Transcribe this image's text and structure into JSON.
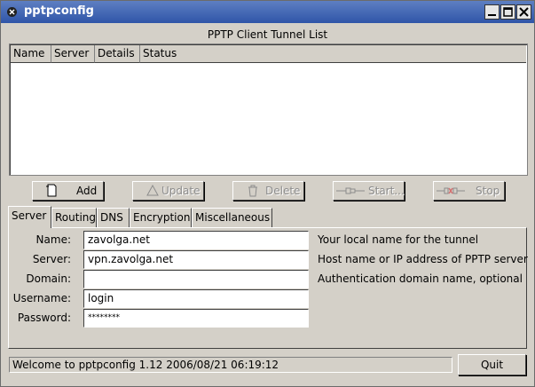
{
  "window": {
    "title": "pptpconfig"
  },
  "list": {
    "caption": "PPTP Client Tunnel List",
    "columns": [
      "Name",
      "Server",
      "Details",
      "Status"
    ]
  },
  "toolbar": {
    "add": "Add",
    "update": "Update",
    "delete": "Delete",
    "start": "Start...",
    "stop": "Stop"
  },
  "tabs": [
    "Server",
    "Routing",
    "DNS",
    "Encryption",
    "Miscellaneous"
  ],
  "server_form": {
    "name_label": "Name:",
    "name_value": "zavolga.net",
    "name_hint": "Your local name for the tunnel",
    "server_label": "Server:",
    "server_value": "vpn.zavolga.net",
    "server_hint": "Host name or IP address of PPTP server",
    "domain_label": "Domain:",
    "domain_value": "",
    "domain_hint": "Authentication domain name, optional",
    "username_label": "Username:",
    "username_value": "login",
    "password_label": "Password:",
    "password_value": "********"
  },
  "statusbar": {
    "text": "Welcome to pptpconfig 1.12 2006/08/21 06:19:12"
  },
  "quit_label": "Quit"
}
